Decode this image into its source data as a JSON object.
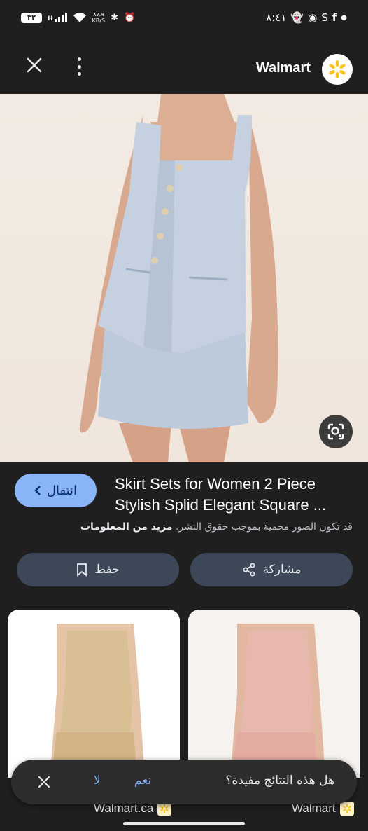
{
  "status_bar": {
    "time": "٨:٤١",
    "battery": "٣٢",
    "network": "H",
    "net_speed_value": "٨٧.٩",
    "net_speed_unit": "KB/S",
    "notification_icons": [
      "dot-icon",
      "facebook-icon",
      "skype-icon",
      "messenger-icon",
      "snapchat-icon"
    ]
  },
  "app_bar": {
    "site_name": "Walmart",
    "close_icon": "close-icon",
    "menu_icon": "more-vert-icon"
  },
  "product": {
    "title_line1": "Skirt Sets for Women 2 Piece",
    "title_line2": "Stylish Splid Elegant Square ...",
    "visit_label": "انتقال",
    "copyright_notice": "قد تكون الصور محمية بموجب حقوق النشر.",
    "more_info_label": "مزيد من المعلومات",
    "share_label": "مشاركة",
    "save_label": "حفظ"
  },
  "results": [
    {
      "site": "Walmart.ca",
      "garment_color": "#d9bf94"
    },
    {
      "site": "Walmart",
      "garment_color": "#e8b7ae"
    }
  ],
  "feedback": {
    "question": "هل هذه النتائج مفيدة؟",
    "yes_label": "نعم",
    "no_label": "لا"
  },
  "colors": {
    "background": "#1f1f1f",
    "accent": "#8ab4f8",
    "button_bg": "#3c4758",
    "hero_garment": "#c5d1e0",
    "walmart_spark": "#ffc220"
  }
}
